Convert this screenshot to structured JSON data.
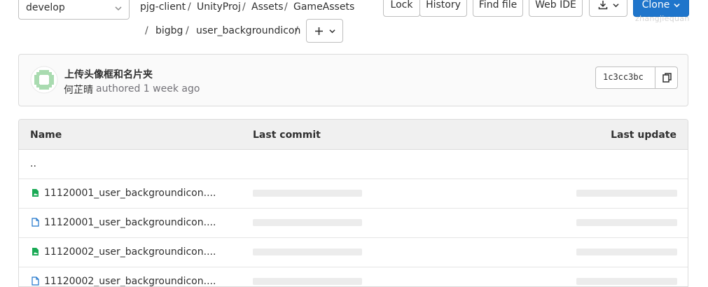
{
  "branch": {
    "value": "develop"
  },
  "breadcrumb": [
    "pjg-client",
    "UnityProj",
    "Assets",
    "GameAssets",
    "bigbg",
    "user_backgroundicon"
  ],
  "toolbar": {
    "lock": "Lock",
    "history": "History",
    "find_file": "Find file",
    "web_ide": "Web IDE",
    "clone": "Clone"
  },
  "tooltip": "zhangjiequan",
  "commit": {
    "title": "上传头像框和名片夹",
    "author": "何芷晴",
    "meta": "authored 1 week ago",
    "sha": "1c3cc3bc"
  },
  "table": {
    "headers": {
      "name": "Name",
      "last_commit": "Last commit",
      "last_update": "Last update"
    },
    "parent": "..",
    "rows": [
      {
        "name": "11120001_user_backgroundicon....",
        "icon": "file-image-icon"
      },
      {
        "name": "11120001_user_backgroundicon....",
        "icon": "file-icon"
      },
      {
        "name": "11120002_user_backgroundicon....",
        "icon": "file-image-icon"
      },
      {
        "name": "11120002_user_backgroundicon....",
        "icon": "file-icon"
      }
    ]
  },
  "colors": {
    "accent": "#1f75cb",
    "image_icon": "#1aaa55",
    "file_icon": "#1f75cb"
  }
}
